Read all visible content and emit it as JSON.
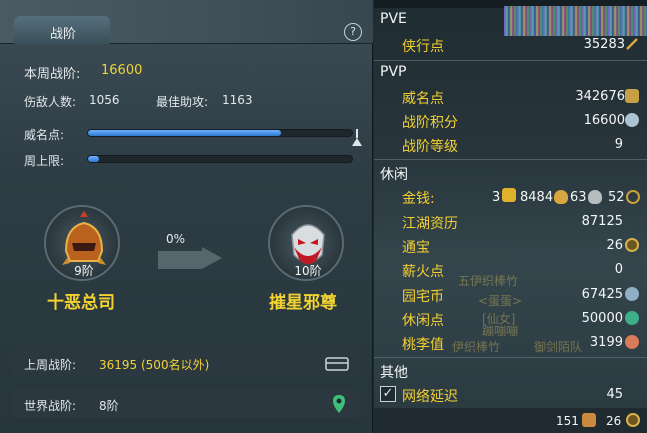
{
  "left": {
    "title": "战阶",
    "help": "?",
    "weekly_label": "本周战阶:",
    "weekly_value": "16600",
    "kills_label": "伤敌人数:",
    "kills_value": "1056",
    "assist_label": "最佳助攻:",
    "assist_value": "1163",
    "prestige_label": "威名点:",
    "prestige_fill": 0.73,
    "weekly_cap_label": "周上限:",
    "weekly_cap_fill": 0.04,
    "current_rank": {
      "level": "9阶",
      "name": "十恶总司"
    },
    "progress_pct": "0%",
    "next_rank": {
      "level": "10阶",
      "name": "摧星邪尊"
    },
    "last_week_label": "上周战阶:",
    "last_week_value": "36195 (500名以外)",
    "world_label": "世界战阶:",
    "world_value": "8阶"
  },
  "right": {
    "pve_title": "PVE",
    "pvp_title": "PVP",
    "leisure_title": "休闲",
    "other_title": "其他",
    "rows": {
      "xiaxing": {
        "label": "侠行点",
        "value": "35283"
      },
      "weiming": {
        "label": "威名点",
        "value": "342676"
      },
      "zhanjie_score": {
        "label": "战阶积分",
        "value": "16600"
      },
      "zhanjie_level": {
        "label": "战阶等级",
        "value": "9"
      },
      "money": {
        "label": "金钱:",
        "gold": "3",
        "silver": "8484",
        "copper1": "63",
        "copper2": "52"
      },
      "jianghu": {
        "label": "江湖资历",
        "value": "87125"
      },
      "tongbao": {
        "label": "通宝",
        "value": "26"
      },
      "xinhuo": {
        "label": "薪火点",
        "value": "0"
      },
      "yuanzhai": {
        "label": "园宅币",
        "value": "67425"
      },
      "xiuxian": {
        "label": "休闲点",
        "value": "50000"
      },
      "taoli": {
        "label": "桃李值",
        "value": "3199"
      },
      "latency": {
        "label": "网络延迟",
        "value": "45"
      }
    },
    "watermarks": [
      "五伊织棒竹",
      "<蛋蛋>",
      "[仙女]",
      "蹦嘣嘣",
      "伊织棒竹",
      "御剑陌队"
    ],
    "footer": {
      "count_a": "151",
      "count_b": "26"
    }
  },
  "colors": {
    "accent_yellow": "#f0d33a",
    "bar_blue": "#2c78d0"
  }
}
